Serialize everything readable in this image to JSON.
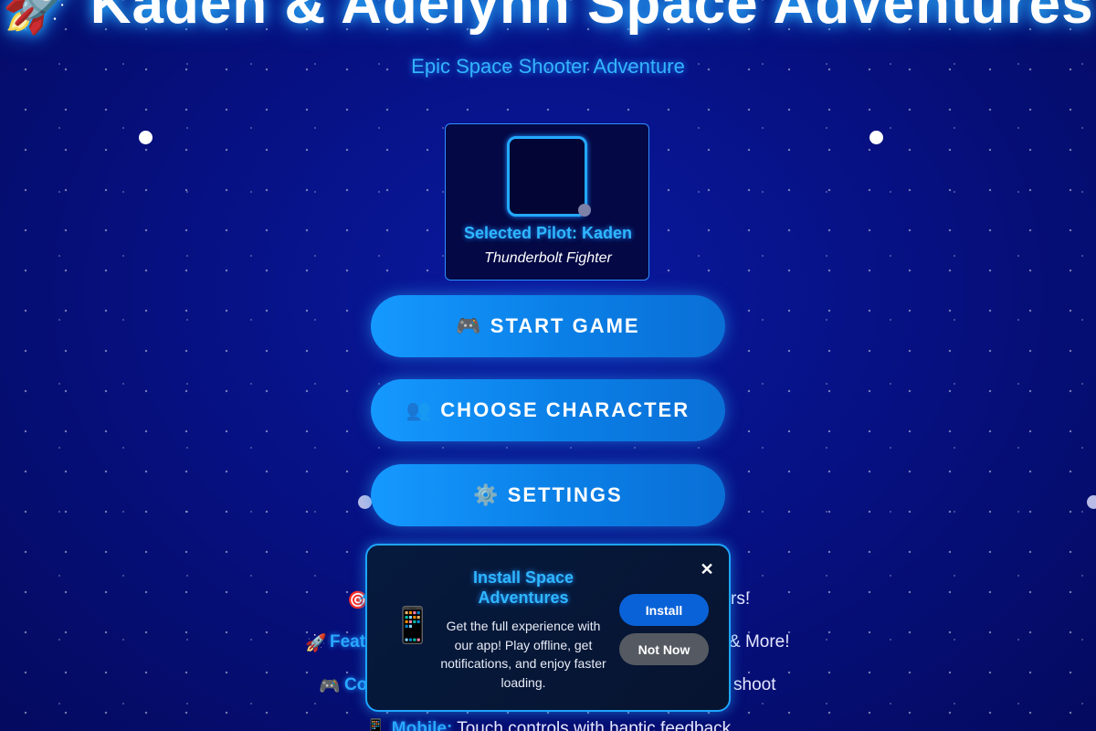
{
  "header": {
    "title": "🚀 Kaden & Adelynn Space Adventures",
    "subtitle": "Epic Space Shooter Adventure"
  },
  "pilot": {
    "label": "Selected Pilot: Kaden",
    "ship": "Thunderbolt Fighter"
  },
  "menu": {
    "start_icon": "🎮",
    "start_label": "START GAME",
    "choose_icon": "👥",
    "choose_label": "CHOOSE CHARACTER",
    "settings_icon": "⚙️",
    "settings_label": "SETTINGS"
  },
  "info": {
    "line1_icon": "🎯",
    "line1_tail": "rs!",
    "line2_icon": "🚀",
    "line2_key": "Feat",
    "line2_tail": "& More!",
    "line3_icon": "🎮",
    "line3_key": "Co",
    "line3_tail": "shoot",
    "mobile_icon": "📱",
    "mobile_key": "Mobile:",
    "mobile_text": "Touch controls with haptic feedback"
  },
  "install_prompt": {
    "phone_icon": "📱",
    "title": "Install Space Adventures",
    "description": "Get the full experience with our app! Play offline, get notifications, and enjoy faster loading.",
    "close_icon": "✕",
    "install_label": "Install",
    "not_now_label": "Not Now"
  },
  "colors": {
    "background": "#07118a",
    "accent": "#2fb7ff",
    "button": "#1599ff",
    "install_button": "#0a62d8",
    "not_now_button": "#555a62"
  }
}
